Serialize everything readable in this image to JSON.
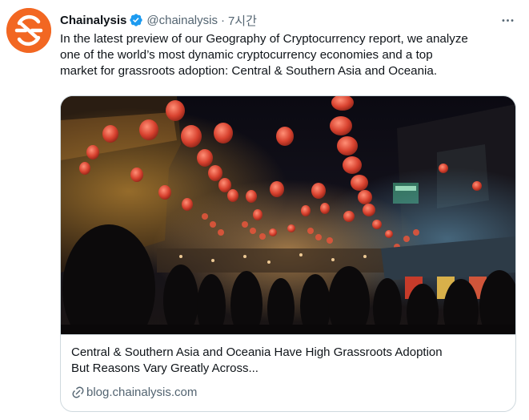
{
  "tweet": {
    "display_name": "Chainalysis",
    "handle": "@chainalysis",
    "separator": "·",
    "time": "7시간",
    "text_lines": [
      "In the latest preview of our Geography of Cryptocurrency report, we analyze",
      "one of the world’s most dynamic cryptocurrency economies and a top",
      "market for grassroots adoption: Central & Southern Asia and Oceania."
    ]
  },
  "card": {
    "title_lines": [
      "Central & Southern Asia and Oceania Have High Grassroots Adoption",
      "But Reasons Vary Greatly Across..."
    ],
    "domain": "blog.chainalysis.com",
    "image_subject": "night market street with hanging red lanterns"
  },
  "icons": {
    "avatar": "chainalysis-logo",
    "verified": "verified-badge-icon",
    "more": "more-dots-icon",
    "link": "link-icon"
  },
  "colors": {
    "brand_orange": "#f26722",
    "verified_blue": "#1d9bf0",
    "secondary_text": "#536471",
    "border": "#cfd9de"
  }
}
